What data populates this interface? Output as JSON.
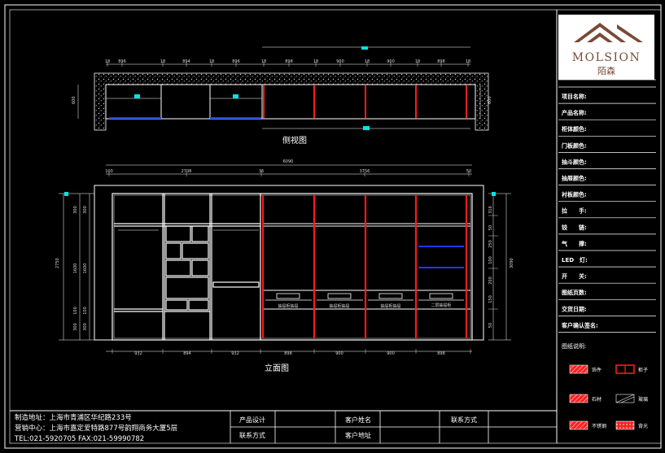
{
  "drawing": {
    "side_view_title": "侧视图",
    "elevation_title": "立面图",
    "colors": {
      "background": "#000000",
      "lines": "#ffffff",
      "red_panel": "#ff1a1a",
      "blue_shelf": "#1a3cff",
      "cyan_marker": "#00e5e5",
      "hatch": "#d0d0d0"
    }
  },
  "side_view": {
    "top_dims": [
      "18",
      "896",
      "18",
      "894",
      "18",
      "896",
      "18",
      "898",
      "18",
      "900",
      "18",
      "900",
      "18",
      "898",
      "18"
    ],
    "left_dim": "600",
    "right_dim": "600"
  },
  "elevation": {
    "overall_width": "6090",
    "section_dims": [
      "100",
      "2708",
      "36",
      "3756",
      "50"
    ],
    "bottom_dims": [
      "932",
      "894",
      "932",
      "898",
      "900",
      "900",
      "898"
    ],
    "left_height": "2750",
    "left_parts": [
      "300",
      "1600",
      "100",
      "300"
    ],
    "right_height": "3090",
    "right_parts": [
      "316",
      "50",
      "250",
      "100",
      "200",
      "150",
      "50"
    ],
    "drawer_labels": [
      "抽屉柜抽屉",
      "抽屉柜抽屉",
      "抽屉柜抽屉",
      "二层抽屉柜"
    ]
  },
  "title_block": {
    "brand_name": "MOLSION",
    "brand_cn": "陌森",
    "fields": [
      "项目名称:",
      "产品名称:",
      "柜体颜色:",
      "门板颜色:",
      "抽斗颜色:",
      "抽屉颜色:",
      "衬板颜色:",
      "拉　　手:",
      "铰　　链:",
      "气　　撑:",
      "LED　灯:",
      "开　　关:",
      "图纸页数:",
      "交货日期:",
      "客户确认签名:"
    ],
    "legend_title": "图纸说明:",
    "legend": [
      {
        "label": "饰件",
        "type": "hatch"
      },
      {
        "label": "柜子",
        "type": "door"
      },
      {
        "label": "石材",
        "type": "hatch"
      },
      {
        "label": "玻璃",
        "type": "glass"
      },
      {
        "label": "不锈钢",
        "type": "hatch"
      },
      {
        "label": "背光",
        "type": "hatch2"
      }
    ]
  },
  "footer": {
    "mfg_address": "制造地址：上海市青浦区华纪路233号",
    "sales_center": "营销中心：上海市嘉定爱特路877号韵翔商务大厦5层",
    "tel_fax": "TEL:021-5920705   FAX:021-59990782",
    "design_label": "产品设计",
    "contact_label": "联系方式",
    "client_name_label": "客户姓名",
    "client_address_label": "客户地址",
    "contact_label_right": "联系方式"
  }
}
